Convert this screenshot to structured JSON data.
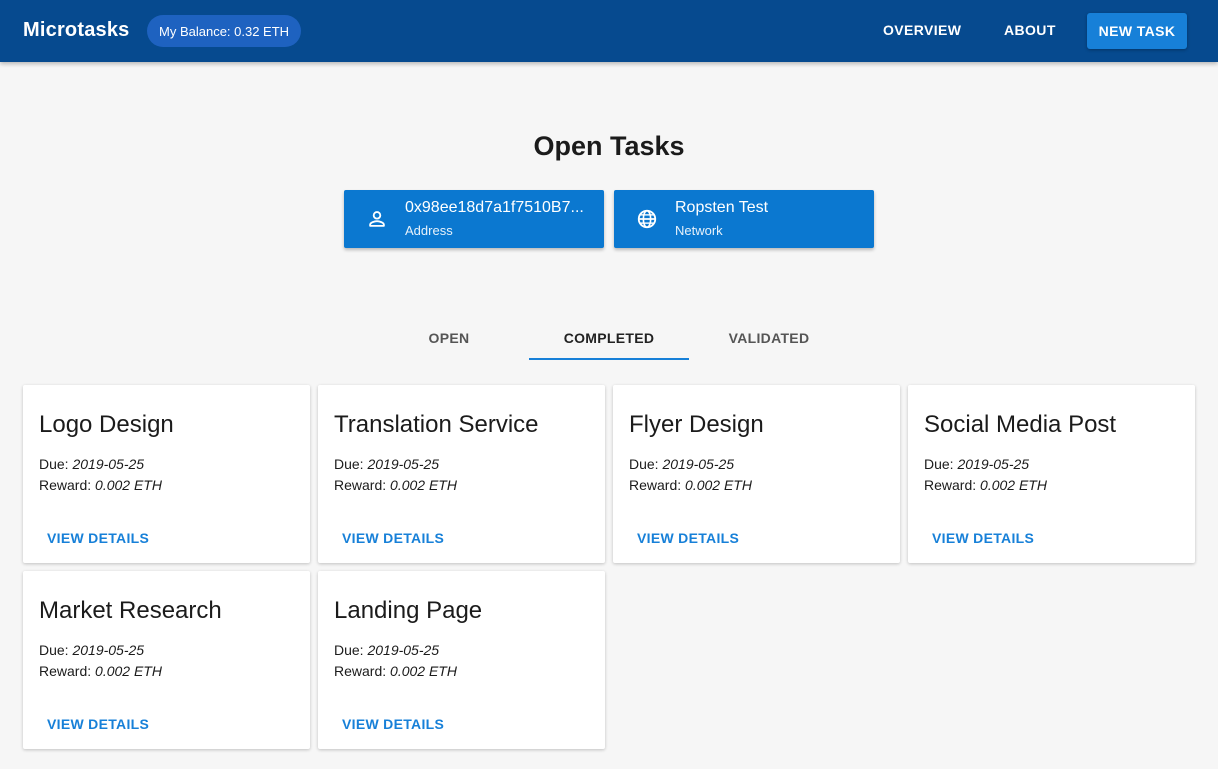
{
  "appbar": {
    "title": "Microtasks",
    "balance": "My Balance: 0.32 ETH",
    "nav": {
      "overview": "OVERVIEW",
      "about": "ABOUT",
      "new_task": "NEW TASK"
    }
  },
  "main": {
    "title": "Open Tasks",
    "address": {
      "value": "0x98ee18d7a1f7510B7...",
      "label": "Address",
      "icon": "person-icon"
    },
    "network": {
      "value": "Ropsten Test",
      "label": "Network",
      "icon": "globe-icon"
    },
    "tabs": [
      {
        "label": "OPEN",
        "active": false
      },
      {
        "label": "COMPLETED",
        "active": true
      },
      {
        "label": "VALIDATED",
        "active": false
      }
    ]
  },
  "task_labels": {
    "due": "Due:",
    "reward": "Reward:",
    "action": "VIEW DETAILS"
  },
  "tasks": [
    {
      "title": "Logo Design",
      "due": "2019-05-25",
      "reward": "0.002 ETH"
    },
    {
      "title": "Translation Service",
      "due": "2019-05-25",
      "reward": "0.002 ETH"
    },
    {
      "title": "Flyer Design",
      "due": "2019-05-25",
      "reward": "0.002 ETH"
    },
    {
      "title": "Social Media Post",
      "due": "2019-05-25",
      "reward": "0.002 ETH"
    },
    {
      "title": "Market Research",
      "due": "2019-05-25",
      "reward": "0.002 ETH"
    },
    {
      "title": "Landing Page",
      "due": "2019-05-25",
      "reward": "0.002 ETH"
    }
  ],
  "colors": {
    "appbar": "#064a8f",
    "accent": "#1780d8",
    "chip": "#1e62c0",
    "background": "#f6f6f6"
  }
}
